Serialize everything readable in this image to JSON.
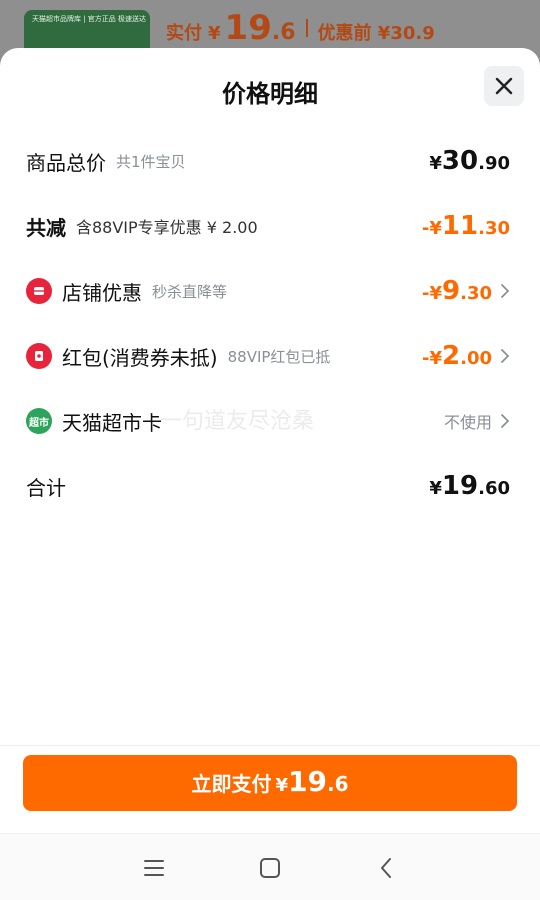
{
  "backdrop": {
    "thumb_text": "天猫超市品牌库 | 官方正品 极速送达",
    "paid_label": "实付",
    "currency": "¥",
    "paid_int": "19",
    "paid_dec": ".6",
    "before_label": "优惠前 ¥30.9"
  },
  "sheet": {
    "title": "价格明细",
    "rows": {
      "total": {
        "label": "商品总价",
        "sub": "共1件宝贝",
        "sym": "¥",
        "int": "30",
        "dec": ".90"
      },
      "reduce": {
        "label": "共减",
        "sub": "含88VIP专享优惠 ¥ 2.00",
        "sym": "-¥",
        "int": "11",
        "dec": ".30"
      },
      "shop": {
        "label": "店铺优惠",
        "sub": "秒杀直降等",
        "sym": "-¥",
        "int": "9",
        "dec": ".30"
      },
      "redpack": {
        "label": "红包(消费券未抵)",
        "sub": "88VIP红包已抵",
        "sym": "-¥",
        "int": "2",
        "dec": ".00"
      },
      "card": {
        "label": "天猫超市卡",
        "value": "不使用",
        "icon_text": "超市"
      },
      "sum": {
        "label": "合计",
        "sym": "¥",
        "int": "19",
        "dec": ".60"
      }
    },
    "watermark": "一句道友尽沧桑",
    "pay_button": {
      "label": "立即支付",
      "sym": "¥",
      "int": "19",
      "dec": ".6"
    }
  },
  "colors": {
    "accent": "#ff6a00",
    "shop_icon": "#e8233c",
    "card_icon": "#2ea35b"
  },
  "navbar": {
    "icons": [
      "menu-icon",
      "home-icon",
      "back-icon"
    ]
  }
}
